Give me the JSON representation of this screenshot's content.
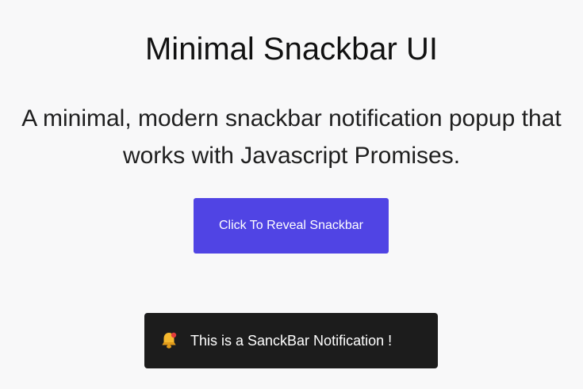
{
  "page": {
    "title": "Minimal Snackbar UI",
    "subtitle_line1": "A minimal, modern snackbar notification popup that",
    "subtitle_line2": "works with Javascript Promises."
  },
  "reveal_button": {
    "label": "Click To Reveal Snackbar"
  },
  "snackbar": {
    "icon": "bell-icon",
    "message": "This is a SanckBar Notification !"
  },
  "colors": {
    "background": "#f8f8f9",
    "accent": "#5044e4",
    "snackbar_bg": "#1c1c1c"
  }
}
